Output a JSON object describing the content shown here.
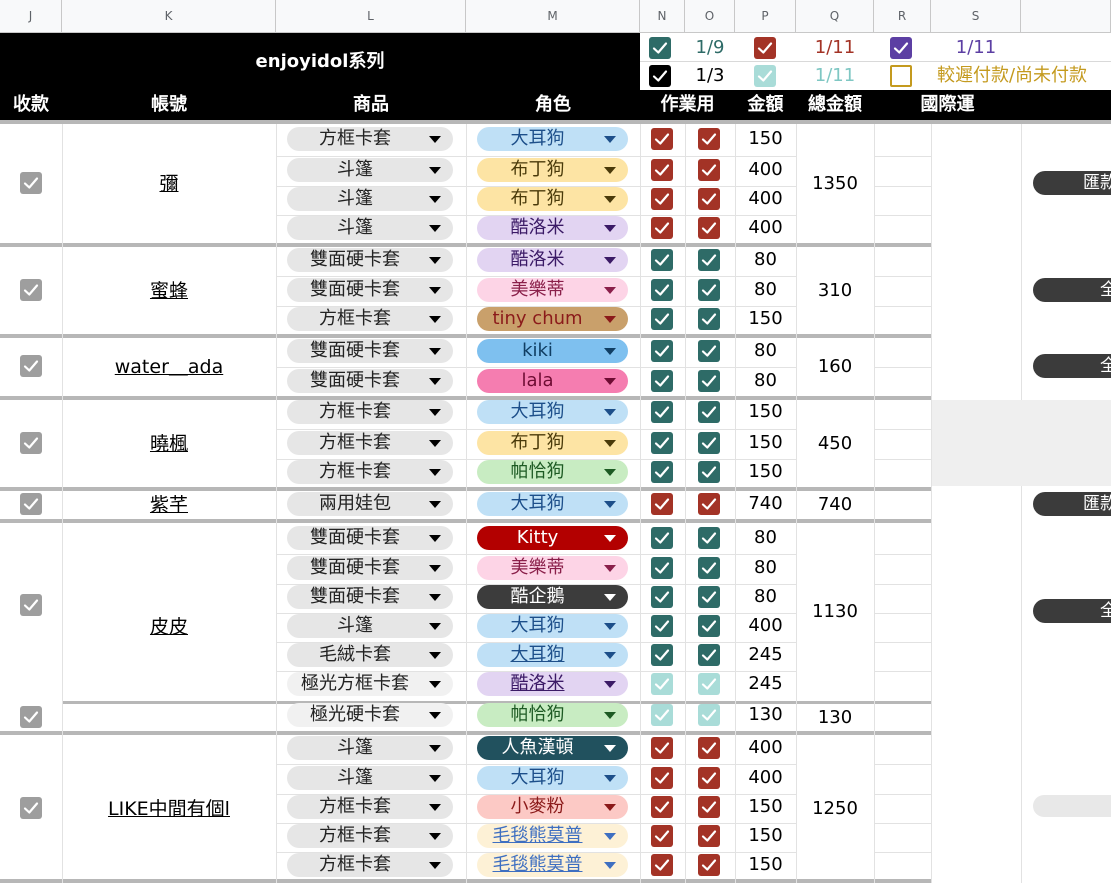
{
  "column_letters": [
    "J",
    "K",
    "L",
    "M",
    "N",
    "O",
    "P",
    "Q",
    "R",
    "S"
  ],
  "group_title": "enjoyidol系列",
  "legend": [
    {
      "text": "1/9",
      "text_color": "#2e6b67",
      "checkbox_color": "#2e6b67"
    },
    {
      "text": "1/11",
      "text_color": "#a33326",
      "checkbox_color": "#a33326"
    },
    {
      "text": "1/11",
      "text_color": "#5c3fa3",
      "checkbox_color": "#5c3fa3"
    },
    {
      "text": "1/3",
      "text_color": "#000000",
      "checkbox_color": "#000000"
    },
    {
      "text": "1/11",
      "text_color": "#7fc7c3",
      "checkbox_color": "#a9dcd8"
    },
    {
      "text": "較遲付款/尚未付款",
      "text_color": "#c49a1e",
      "checkbox_color": "#c49a1e"
    }
  ],
  "headers": {
    "paid": "收款",
    "account": "帳號",
    "product": "商品",
    "role": "角色",
    "work": "作業用",
    "amount": "金額",
    "total": "總金額",
    "intl": "國際運"
  },
  "groups": [
    {
      "account": "彌",
      "total": "1350",
      "pill": "匯款",
      "rows": [
        {
          "product": "方框卡套",
          "role": "大耳狗",
          "amount": "150"
        },
        {
          "product": "斗篷",
          "role": "布丁狗",
          "amount": "400"
        },
        {
          "product": "斗篷",
          "role": "布丁狗",
          "amount": "400"
        },
        {
          "product": "斗篷",
          "role": "酷洛米",
          "amount": "400"
        }
      ]
    },
    {
      "account": "蜜蜂",
      "total": "310",
      "pill": "全",
      "rows": [
        {
          "product": "雙面硬卡套",
          "role": "酷洛米",
          "amount": "80"
        },
        {
          "product": "雙面硬卡套",
          "role": "美樂蒂",
          "amount": "80"
        },
        {
          "product": "方框卡套",
          "role": "tiny chum",
          "amount": "150"
        }
      ]
    },
    {
      "account": "water＿ada",
      "total": "160",
      "pill": "全",
      "rows": [
        {
          "product": "雙面硬卡套",
          "role": "kiki",
          "amount": "80"
        },
        {
          "product": "雙面硬卡套",
          "role": "lala",
          "amount": "80"
        }
      ]
    },
    {
      "account": "曉楓",
      "total": "450",
      "rows": [
        {
          "product": "方框卡套",
          "role": "大耳狗",
          "amount": "150"
        },
        {
          "product": "方框卡套",
          "role": "布丁狗",
          "amount": "150"
        },
        {
          "product": "方框卡套",
          "role": "帕恰狗",
          "amount": "150"
        }
      ]
    },
    {
      "account": "紫芊",
      "total": "740",
      "pill": "匯款",
      "rows": [
        {
          "product": "兩用娃包",
          "role": "大耳狗",
          "amount": "740"
        }
      ]
    },
    {
      "account": "皮皮",
      "total": "1130",
      "pill": "全",
      "rows": [
        {
          "product": "雙面硬卡套",
          "role": "Kitty",
          "amount": "80"
        },
        {
          "product": "雙面硬卡套",
          "role": "美樂蒂",
          "amount": "80"
        },
        {
          "product": "雙面硬卡套",
          "role": "酷企鵝",
          "amount": "80"
        },
        {
          "product": "斗篷",
          "role": "大耳狗",
          "amount": "400"
        },
        {
          "product": "毛絨卡套",
          "role": "大耳狗",
          "amount": "245"
        },
        {
          "product": "極光方框卡套",
          "role": "酷洛米",
          "amount": "245"
        }
      ]
    },
    {
      "account": "",
      "total": "130",
      "rows": [
        {
          "product": "極光硬卡套",
          "role": "帕恰狗",
          "amount": "130"
        }
      ]
    },
    {
      "account": "LIKE中間有個l",
      "total": "1250",
      "rows": [
        {
          "product": "斗篷",
          "role": "人魚漢頓",
          "amount": "400"
        },
        {
          "product": "斗篷",
          "role": "大耳狗",
          "amount": "400"
        },
        {
          "product": "方框卡套",
          "role": "小麥粉",
          "amount": "150"
        },
        {
          "product": "方框卡套",
          "role": "毛毯熊莫普",
          "amount": "150"
        },
        {
          "product": "方框卡套",
          "role": "毛毯熊莫普",
          "amount": "150"
        }
      ]
    }
  ],
  "colors": {
    "checked_red": "#a33326",
    "checked_teal": "#2e6b67",
    "checked_light_teal": "#a9dcd8",
    "paid_gray": "#9e9e9e",
    "role_blue": "#bfe0f6",
    "role_yellow": "#fde4a4",
    "role_purple": "#e2d4f2",
    "role_pink": "#fdd4e6",
    "role_tan": "#c9a06b",
    "role_kiki": "#7ec0ef",
    "role_lala": "#f57db0",
    "role_green": "#c8ecc2",
    "role_red": "#b30000",
    "role_dark": "#3c3c3c",
    "role_darkteal": "#21515e",
    "role_salmon": "#fcc9c5",
    "role_cream": "#fdf1d6"
  }
}
